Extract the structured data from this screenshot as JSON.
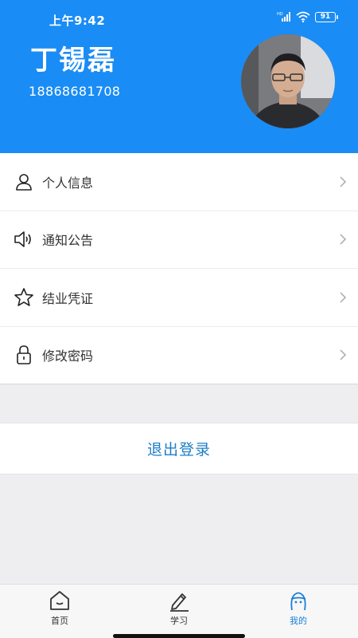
{
  "status_bar": {
    "time": "上午9:42",
    "battery": "91"
  },
  "profile": {
    "name": "丁锡磊",
    "phone": "18868681708"
  },
  "menu": [
    {
      "label": "个人信息",
      "icon": "person-icon"
    },
    {
      "label": "通知公告",
      "icon": "speaker-icon"
    },
    {
      "label": "结业凭证",
      "icon": "star-icon"
    },
    {
      "label": "修改密码",
      "icon": "lock-icon"
    }
  ],
  "logout": {
    "label": "退出登录"
  },
  "tabbar": {
    "tabs": [
      {
        "label": "首页",
        "icon": "home-icon",
        "active": false
      },
      {
        "label": "学习",
        "icon": "pencil-icon",
        "active": false
      },
      {
        "label": "我的",
        "icon": "profile-face-icon",
        "active": true
      }
    ]
  },
  "colors": {
    "header_bg": "#1a8cf5",
    "accent": "#1a7fd8",
    "logout_text": "#1c7fc6"
  }
}
